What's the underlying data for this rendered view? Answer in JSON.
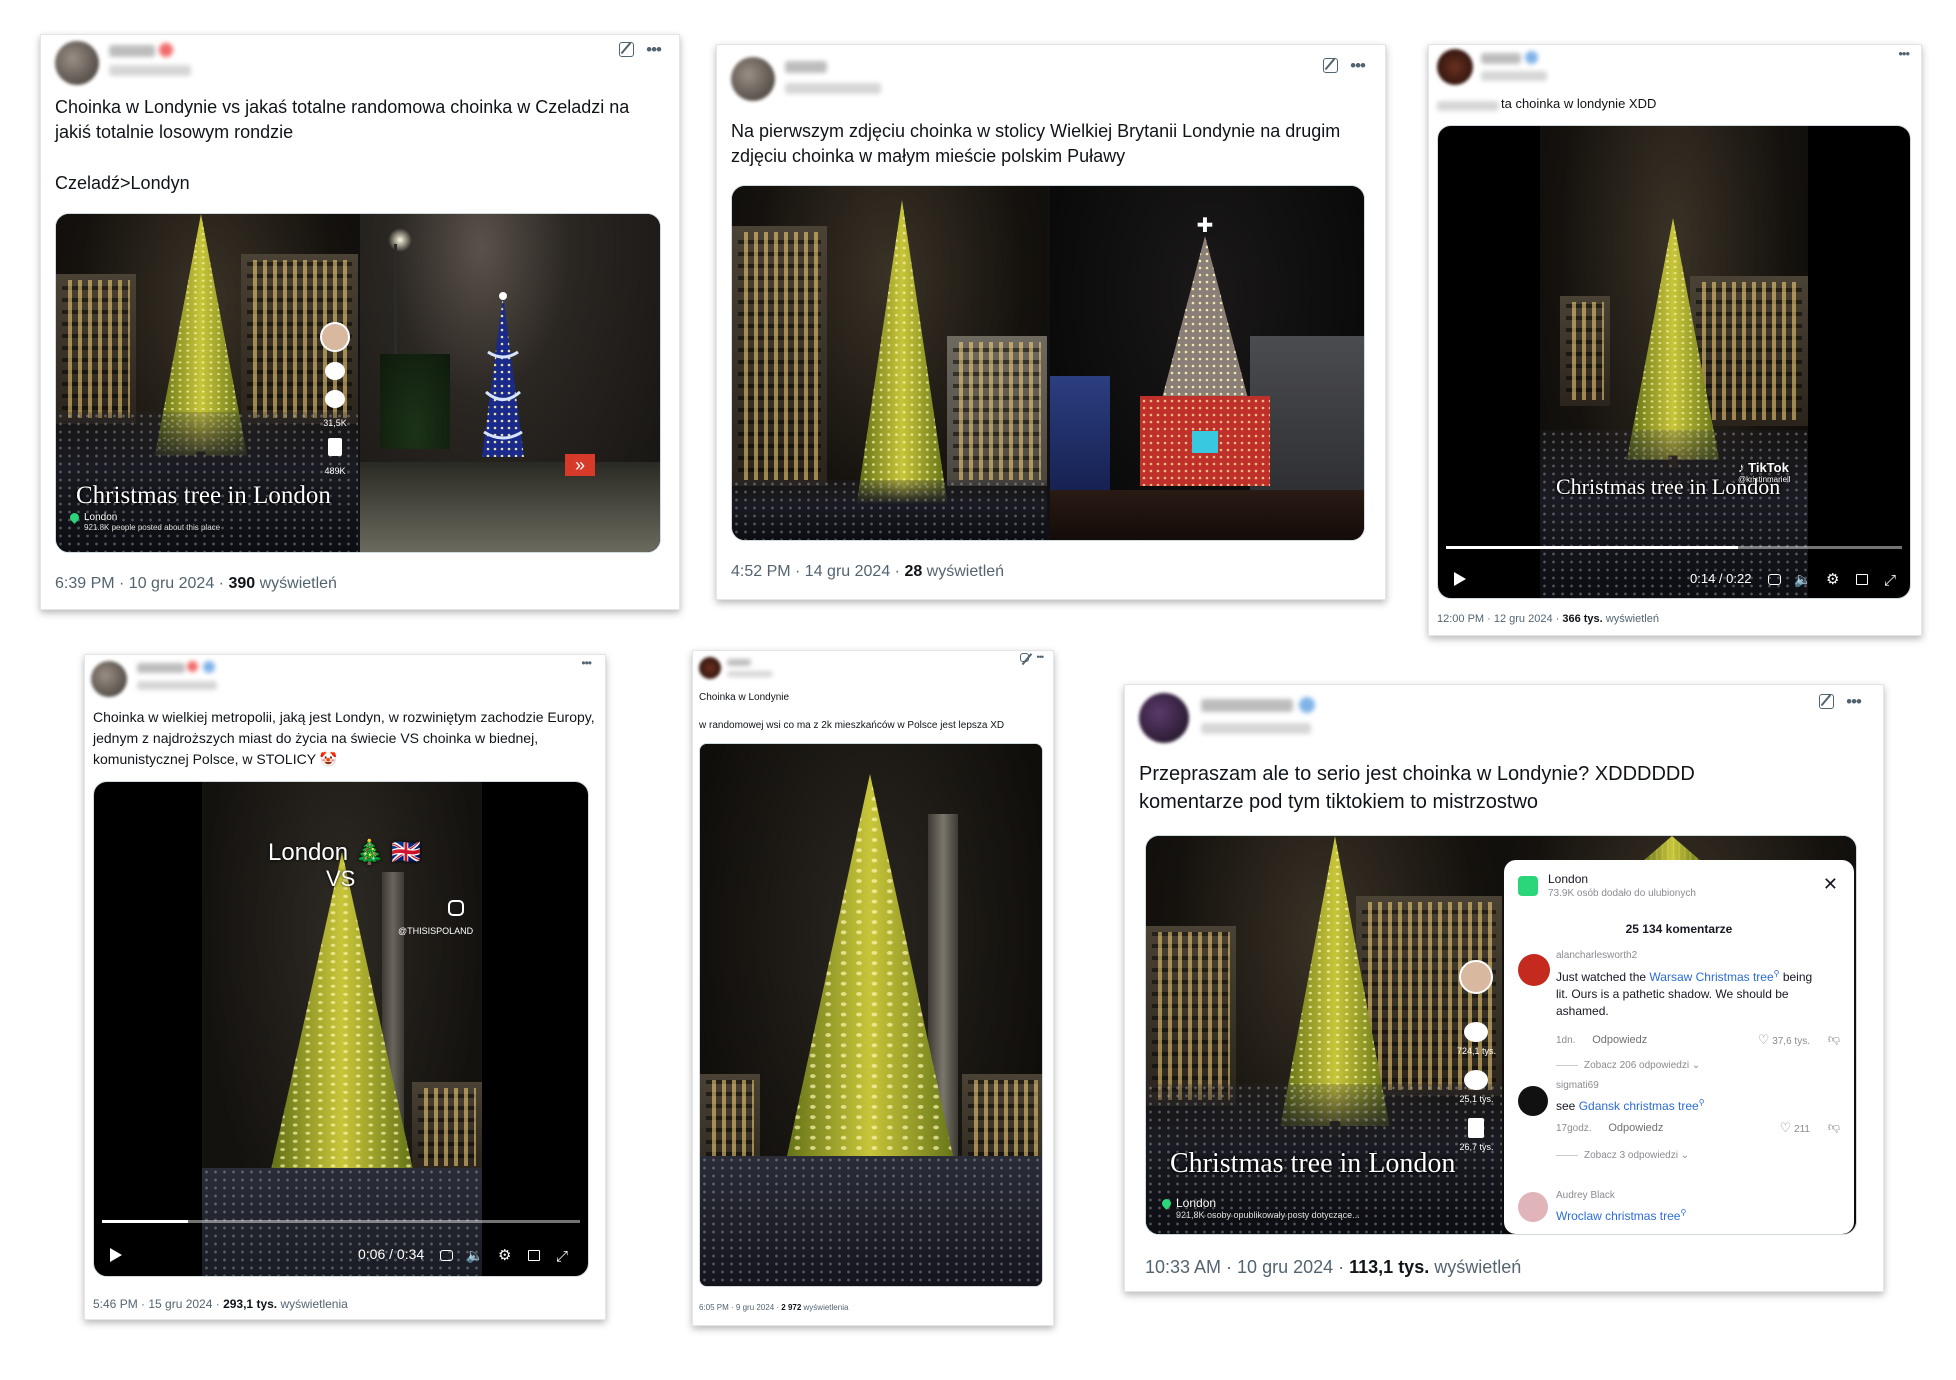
{
  "posts": [
    {
      "text": "Choinka w Londynie vs jakaś totalne randomowa choinka w Czeladzi na jakiś totalnie losowym rondzie",
      "text2": "Czeladź>Londyn",
      "overlay_text": "Christmas tree in London",
      "location": "London",
      "location_sub": "921.8K people posted about this place",
      "side_counts": [
        "31,5K",
        "489K"
      ],
      "time": "6:39 PM · 10 gru 2024 · ",
      "views": "390",
      "views_label": " wyświetleń"
    },
    {
      "text": "Na pierwszym zdjęciu choinka w stolicy Wielkiej Brytanii Londynie na drugim zdjęciu choinka w małym mieście polskim Puławy",
      "time": "4:52 PM · 14 gru 2024 · ",
      "views": "28",
      "views_label": " wyświetleń"
    },
    {
      "text_prefix_hidden": true,
      "text": "ta choinka w londynie XDD",
      "overlay_text": "Christmas tree in London",
      "watermark": "TikTok",
      "watermark_handle": "@kristinmariell",
      "video_time": "0:14 / 0:22",
      "progress": 0.64,
      "time": "12:00 PM · 12 gru 2024 · ",
      "views": "366 tys.",
      "views_label": " wyświetleń"
    },
    {
      "text": "Choinka w wielkiej metropolii, jaką jest Londyn, w rozwiniętym zachodzie Europy, jednym z najdroższych miast do życia na świecie VS choinka w biednej, komunistycznej Polsce, w STOLICY 🤡",
      "overlay_london": "London 🎄 🇬🇧",
      "overlay_vs": "VS",
      "ig_handle": "@THISISPOLAND",
      "video_time": "0:06 / 0:34",
      "progress": 0.18,
      "time": "5:46 PM · 15 gru 2024 · ",
      "views": "293,1 tys.",
      "views_label": " wyświetlenia"
    },
    {
      "text": "Choinka w Londynie",
      "text2": "w randomowej wsi co ma z 2k mieszkańców w Polsce jest lepsza XD",
      "time": "6:05 PM · 9 gru 2024 · ",
      "views": "2 972",
      "views_label": " wyświetlenia"
    },
    {
      "text": "Przepraszam ale to serio jest choinka w Londynie? XDDDDDD komentarze pod tym tiktokiem to mistrzostwo",
      "overlay_text": "Christmas tree in London",
      "location": "London",
      "location_sub": "921,8K osoby opublikowały posty dotyczące...",
      "side_counts": [
        "724,1 tys.",
        "25,1 tys.",
        "26,7 tys."
      ],
      "time": "10:33 AM · 10 gru 2024 · ",
      "views": "113,1 tys.",
      "views_label": " wyświetleń",
      "comments_panel": {
        "title": "London",
        "subtitle": "73.9K osób dodało do ulubionych",
        "count": "25 134 komentarze",
        "close": "✕",
        "comments": [
          {
            "user": "alancharlesworth2",
            "before": "Just watched the ",
            "link": "Warsaw Christmas tree",
            "after": " being lit. Ours is a pathetic shadow. We should be ashamed.",
            "age": "1dn.",
            "reply": "Odpowiedz",
            "likes": "37,6 tys.",
            "more": "Zobacz 206 odpowiedzi"
          },
          {
            "user": "sigmati69",
            "before": "see ",
            "link": "Gdansk christmas tree",
            "after": "",
            "age": "17godz.",
            "reply": "Odpowiedz",
            "likes": "211",
            "more": "Zobacz 3 odpowiedzi"
          },
          {
            "user": "Audrey Black",
            "before": "",
            "link": "Wroclaw christmas tree",
            "after": ""
          }
        ]
      }
    }
  ],
  "colors": {
    "text": "#0f1419",
    "muted": "#536471",
    "link": "#2b6cd6",
    "tree": "#c8c02a"
  }
}
